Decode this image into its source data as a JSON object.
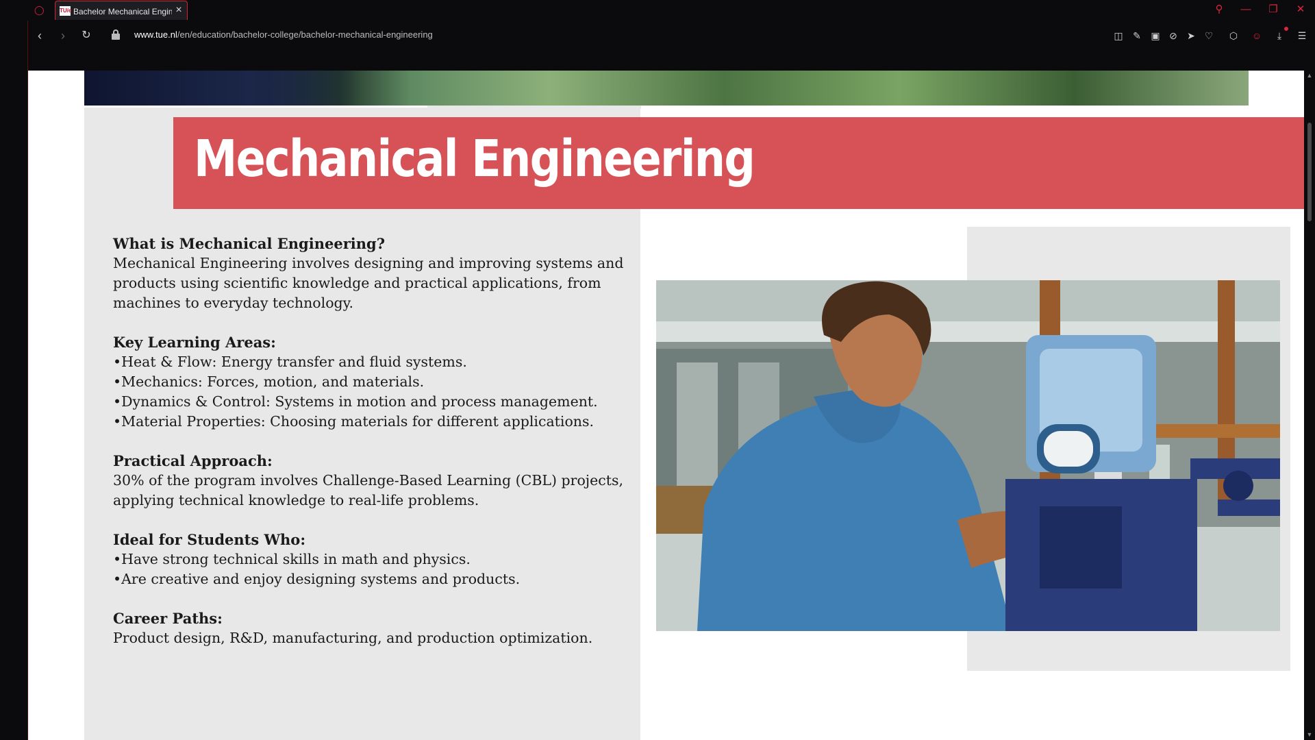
{
  "browser": {
    "tab_title": "Bachelor Mechanical Engineering",
    "favicon_text": "TU/e",
    "url_domain": "www.tue.nl",
    "url_path": "/en/education/bachelor-college/bachelor-mechanical-engineering",
    "accent_color": "#e0233c"
  },
  "page": {
    "title": "Mechanical Engineering",
    "banner_color": "#d65257",
    "sections": [
      {
        "heading": "What is Mechanical Engineering?",
        "lines": [
          "Mechanical Engineering involves designing and improving systems and",
          "products using scientific knowledge and practical applications, from",
          "machines to everyday technology."
        ]
      },
      {
        "heading": "Key Learning Areas:",
        "lines": [
          "•Heat & Flow: Energy transfer and fluid systems.",
          "•Mechanics: Forces, motion, and materials.",
          "•Dynamics & Control: Systems in motion and process management.",
          "•Material Properties: Choosing materials for different applications."
        ]
      },
      {
        "heading": "Practical Approach:",
        "lines": [
          "30% of the program involves Challenge-Based Learning (CBL) projects,",
          "applying technical knowledge to real-life problems."
        ]
      },
      {
        "heading": "Ideal for Students Who:",
        "lines": [
          "•Have strong technical skills in math and physics.",
          "•Are creative and enjoy designing systems and products."
        ]
      },
      {
        "heading": "Career Paths:",
        "lines": [
          "Product design, R&D, manufacturing, and production optimization."
        ]
      }
    ]
  }
}
